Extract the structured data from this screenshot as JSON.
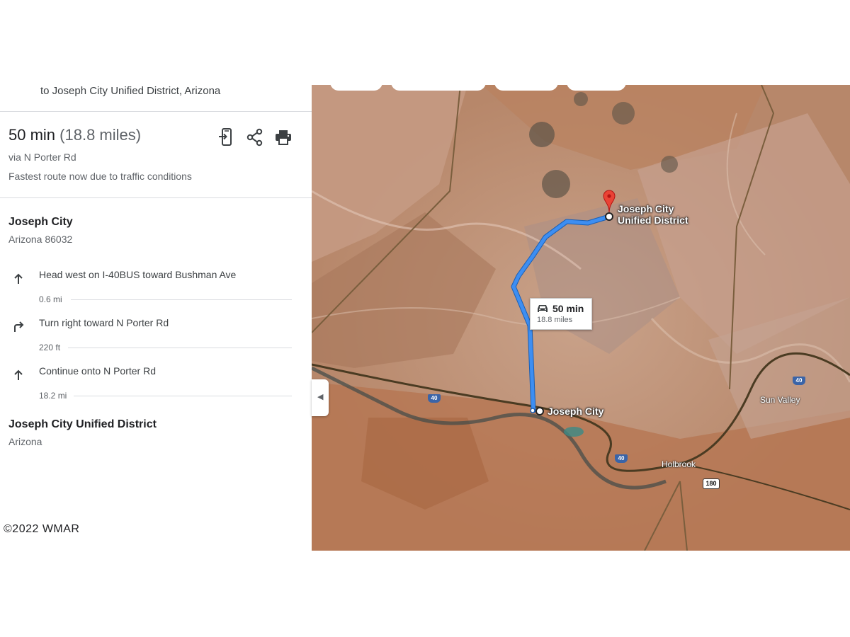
{
  "directions": {
    "destination_line": "to Joseph City Unified District, Arizona",
    "duration": "50 min",
    "distance": "(18.8 miles)",
    "via": "via N Porter Rd",
    "note": "Fastest route now due to traffic conditions",
    "actions": [
      {
        "name": "send-to-phone",
        "icon": "send-to-phone-icon"
      },
      {
        "name": "share",
        "icon": "share-icon"
      },
      {
        "name": "print",
        "icon": "print-icon"
      }
    ],
    "origin": {
      "name": "Joseph City",
      "sub": "Arizona 86032"
    },
    "steps": [
      {
        "icon": "arrow-up-icon",
        "text": "Head west on I-40BUS toward Bushman Ave",
        "distance": "0.6 mi"
      },
      {
        "icon": "turn-right-icon",
        "text": "Turn right toward N Porter Rd",
        "distance": "220 ft"
      },
      {
        "icon": "arrow-up-icon",
        "text": "Continue onto N Porter Rd",
        "distance": "18.2 mi"
      }
    ],
    "destination": {
      "name": "Joseph City Unified District",
      "sub": "Arizona"
    }
  },
  "watermark": "©2022  WMAR",
  "map": {
    "route_card": {
      "duration": "50 min",
      "distance": "18.8 miles"
    },
    "labels": {
      "destination": "Joseph City Unified District",
      "origin": "Joseph City",
      "holbrook": "Holbrook",
      "sun_valley": "Sun Valley"
    },
    "shields": {
      "i40_a": "40",
      "i40_b": "40",
      "i40_c": "40",
      "us180": "180"
    },
    "colors": {
      "route": "#3d8ef2",
      "pin": "#ea4335",
      "terrain": "#b7876a"
    }
  }
}
